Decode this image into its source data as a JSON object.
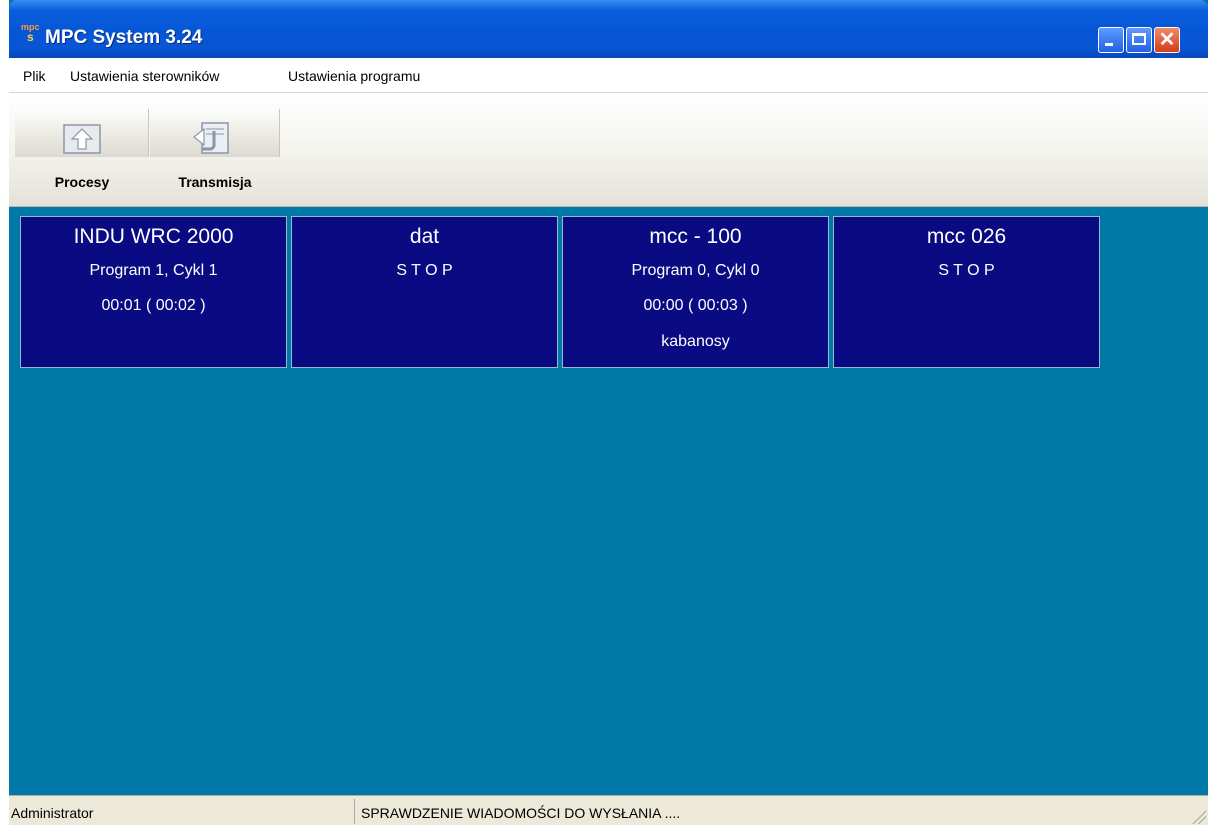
{
  "window": {
    "title": "MPC System 3.24",
    "icon_label_top": "mpc",
    "icon_label_bottom": "s"
  },
  "menu": [
    {
      "label": "Plik"
    },
    {
      "label": "Ustawienia sterowników"
    },
    {
      "label": "Ustawienia programu"
    }
  ],
  "toolbar": [
    {
      "label": "Procesy",
      "icon": "process-upload-icon"
    },
    {
      "label": "Transmisja",
      "icon": "transmission-return-icon"
    }
  ],
  "panels": [
    {
      "name": "INDU WRC 2000",
      "line1": "Program 1, Cykl 1",
      "line2": "00:01  ( 00:02 )",
      "line3": ""
    },
    {
      "name": "dat",
      "line1": "S T O P",
      "line2": "",
      "line3": ""
    },
    {
      "name": "mcc - 100",
      "line1": "Program 0, Cykl 0",
      "line2": "00:00  ( 00:03 )",
      "line3": "kabanosy"
    },
    {
      "name": "mcc 026",
      "line1": "S T O P",
      "line2": "",
      "line3": ""
    }
  ],
  "status": {
    "user": "Administrator",
    "message": "SPRAWDZENIE WIADOMOŚCI DO WYSŁANIA ...."
  },
  "colors": {
    "client_bg": "#0079a8",
    "panel_bg": "#0a0a82",
    "titlebar": "#0556d6"
  }
}
